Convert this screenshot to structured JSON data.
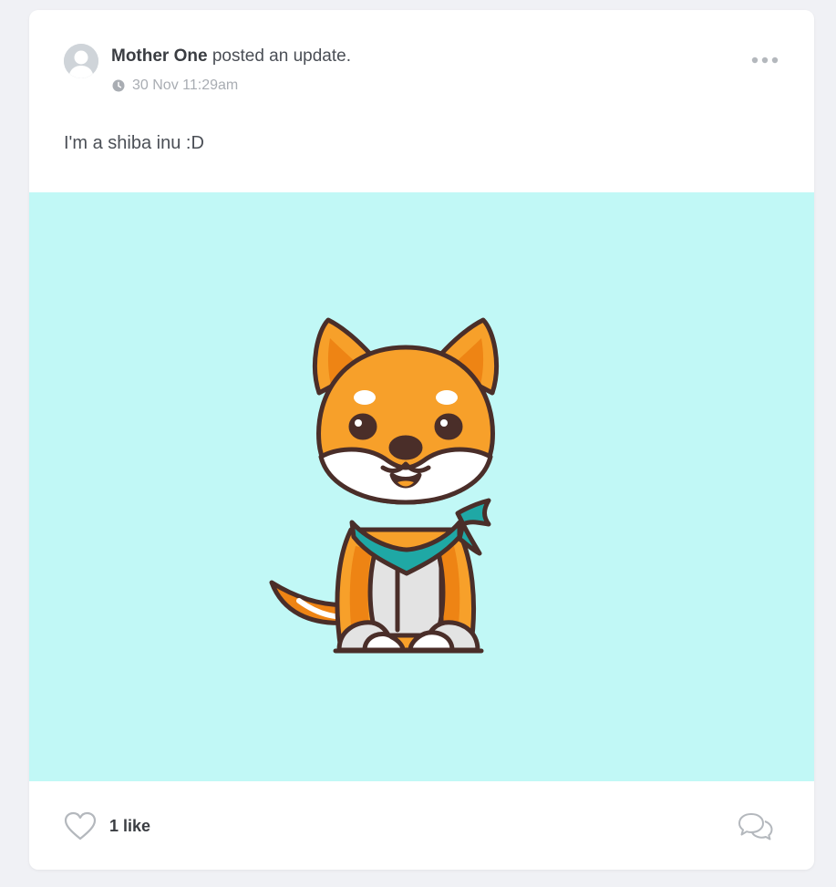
{
  "post": {
    "author": "Mother One",
    "action": "posted an update.",
    "timestamp": "30 Nov 11:29am",
    "text": "I'm a shiba inu :D",
    "image_subject": "shiba-inu-illustration",
    "more_icon": "ellipsis-icon",
    "clock_icon": "clock-icon"
  },
  "footer": {
    "likes_label": "1 like",
    "heart_icon": "heart-icon",
    "comment_icon": "comment-bubbles-icon"
  },
  "colors": {
    "page_background": "#f0f1f5",
    "card_background": "#ffffff",
    "image_background": "#c1f8f6",
    "dog_orange": "#f7a02a",
    "dog_dark_orange": "#ee8414",
    "bandana_teal": "#1fa8a5",
    "outline_brown": "#4a2e29"
  }
}
